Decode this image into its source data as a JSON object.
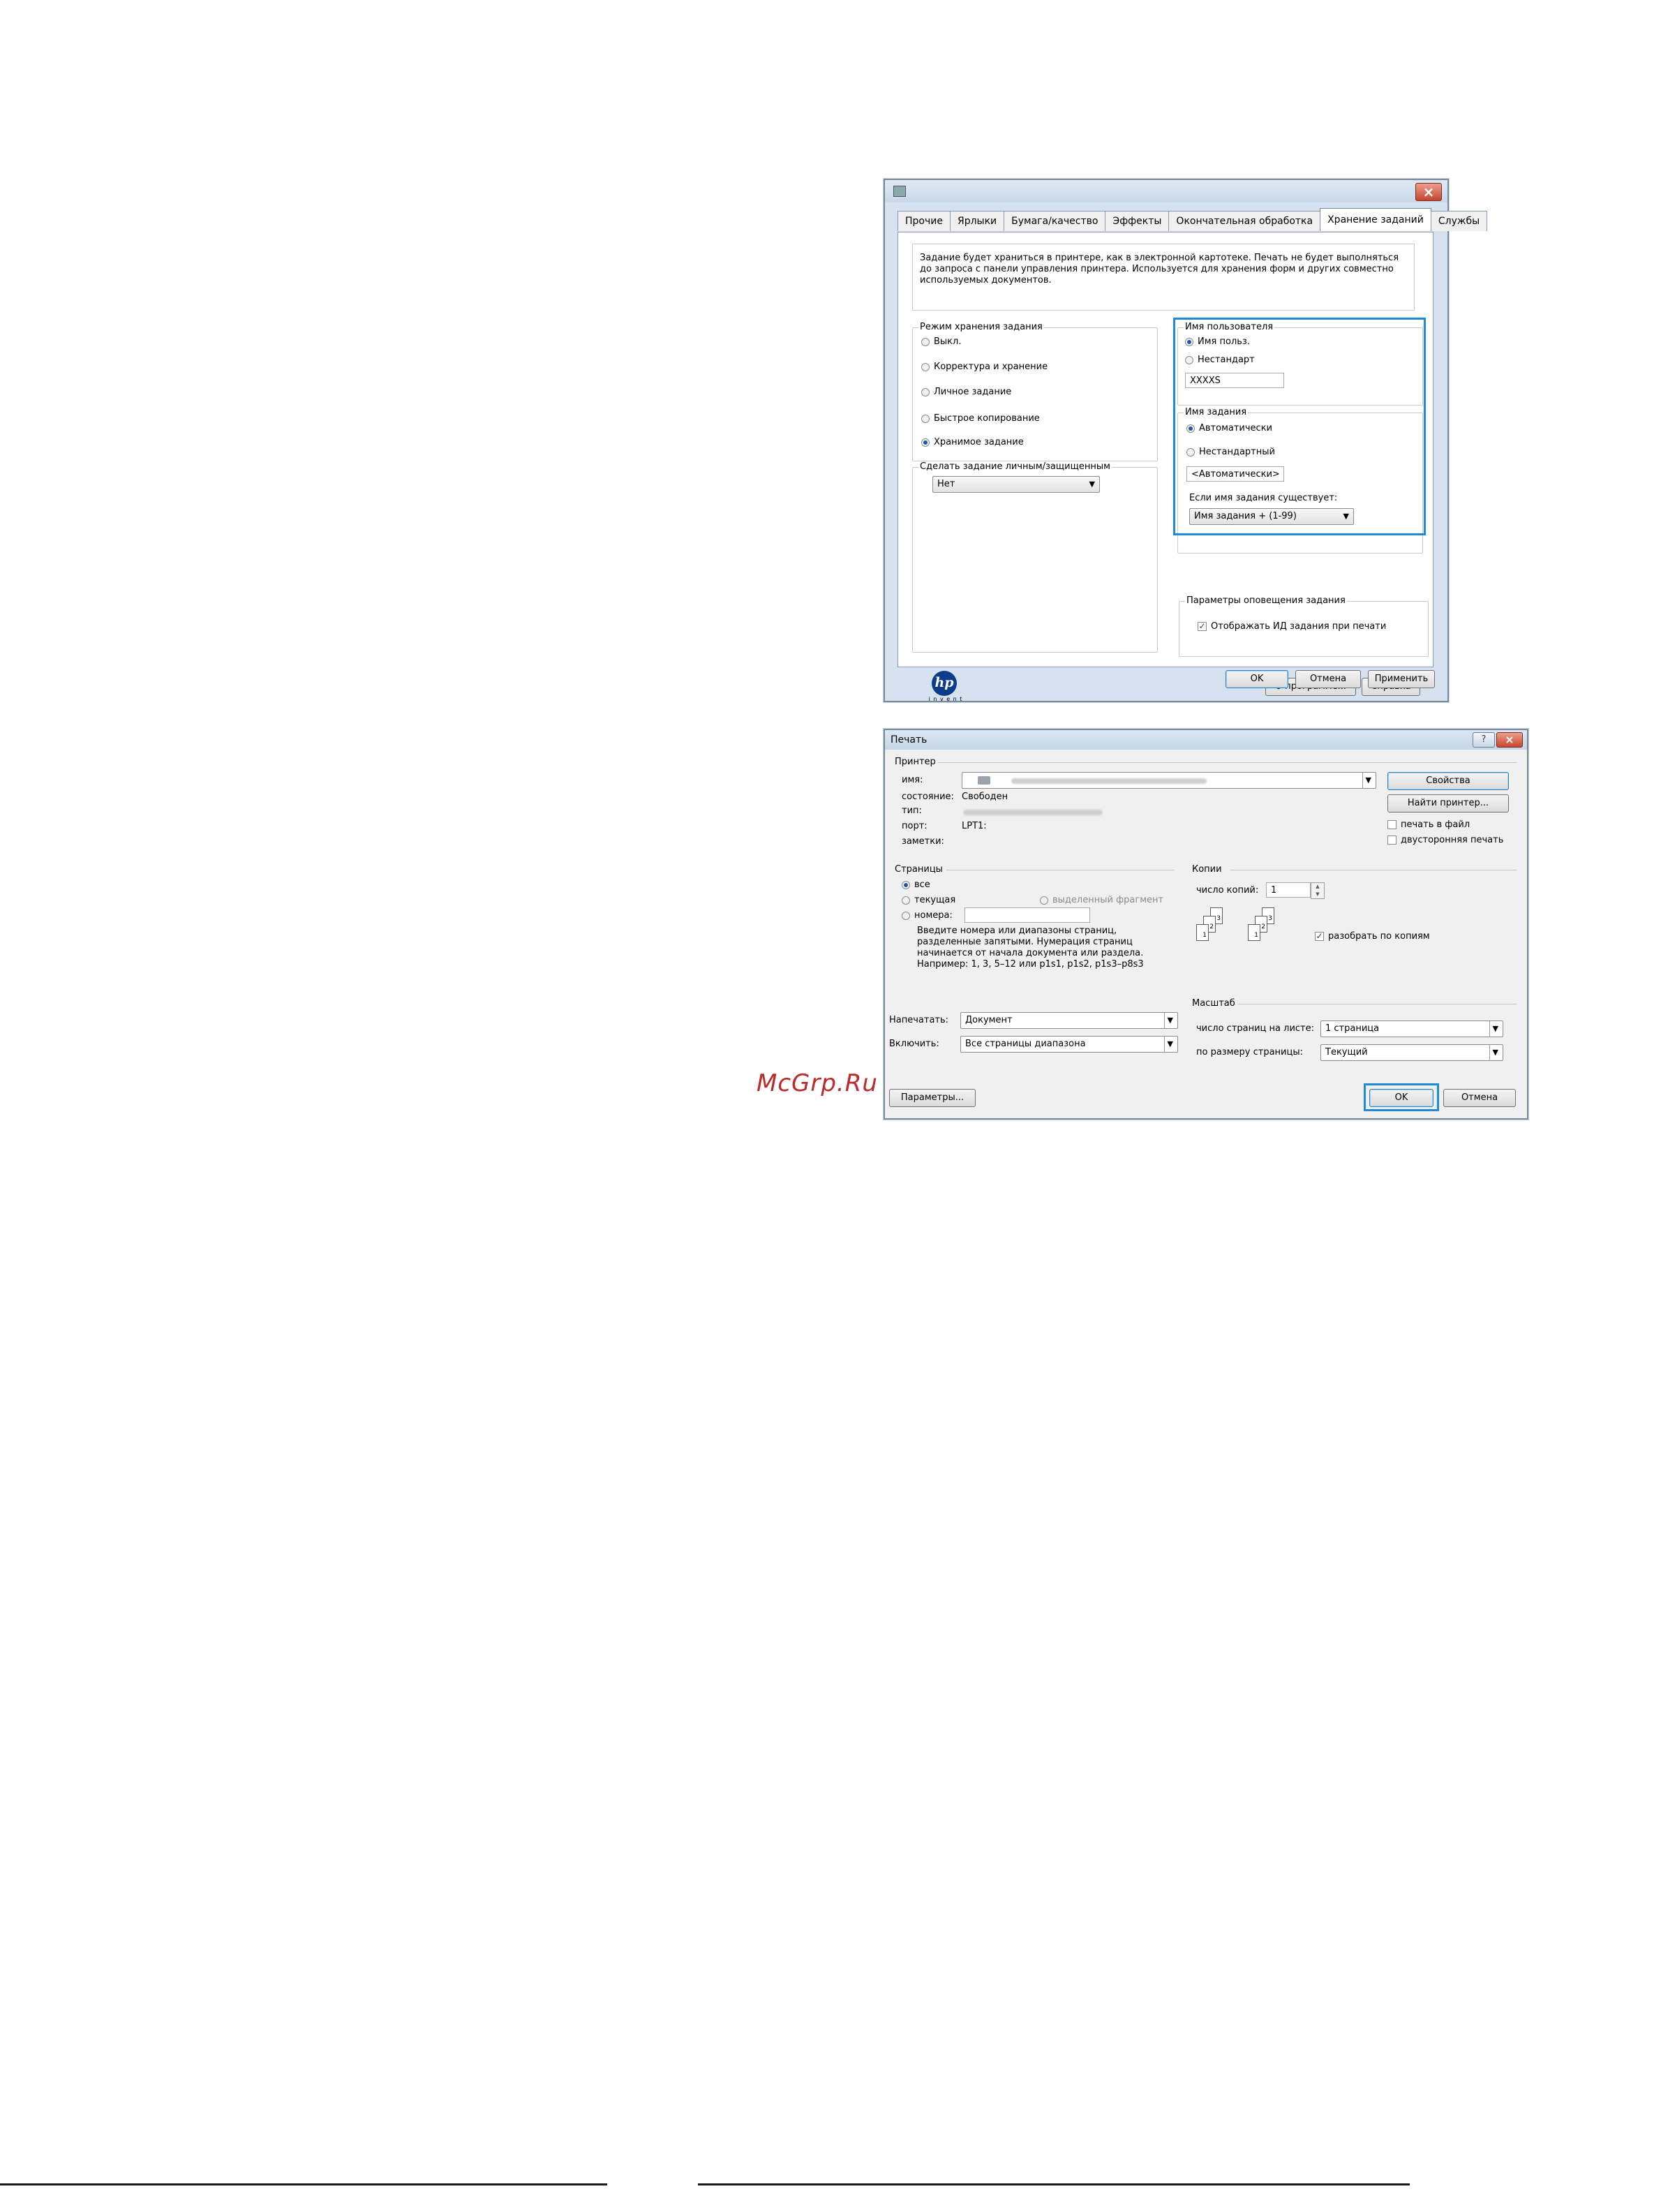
{
  "properties_dialog": {
    "tabs": [
      "Прочие",
      "Ярлыки",
      "Бумага/качество",
      "Эффекты",
      "Окончательная обработка",
      "Хранение заданий",
      "Службы"
    ],
    "active_tab": "Хранение заданий",
    "description": "Задание будет храниться в принтере, как в электронной картотеке. Печать не будет выполняться до запроса с панели управления принтера. Используется для хранения форм и других совместно используемых документов.",
    "storage_mode": {
      "label": "Режим хранения задания",
      "options": [
        "Выкл.",
        "Корректура и хранение",
        "Личное задание",
        "Быстрое копирование",
        "Хранимое задание"
      ],
      "selected": "Хранимое задание"
    },
    "private": {
      "label": "Сделать задание личным/защищенным",
      "value": "Нет"
    },
    "user_name": {
      "label": "Имя пользователя",
      "options": [
        "Имя польз.",
        "Нестандарт"
      ],
      "value": "XXXXS"
    },
    "job_name": {
      "label": "Имя задания",
      "options": [
        "Автоматически",
        "Нестандартный"
      ],
      "value": "<Автоматически>",
      "exists_label": "Если имя задания существует:",
      "exists_value": "Имя задания + (1-99)"
    },
    "notification": {
      "label": "Параметры оповещения задания",
      "checkbox": "Отображать ИД задания при печати",
      "checked": true
    },
    "logo_text": "i n v e n t",
    "buttons": {
      "about": "О программе...",
      "help": "Справка",
      "ok": "OK",
      "cancel": "Отмена",
      "apply": "Применить"
    }
  },
  "print_dialog": {
    "title": "Печать",
    "printer": {
      "label": "Принтер",
      "name_label": "имя:",
      "status_label": "состояние:",
      "status_value": "Свободен",
      "type_label": "тип:",
      "port_label": "порт:",
      "port_value": "LPT1:",
      "notes_label": "заметки:",
      "properties_button": "Свойства",
      "find_button": "Найти принтер...",
      "print_to_file": "печать в файл",
      "duplex": "двусторонняя печать"
    },
    "pages": {
      "label": "Страницы",
      "all": "все",
      "current": "текущая",
      "selection": "выделенный фрагмент",
      "numbers": "номера:",
      "hint": [
        "Введите номера или диапазоны страниц,",
        "разделенные запятыми. Нумерация страниц",
        "начинается от начала документа или раздела.",
        "Например: 1, 3, 5–12 или p1s1, p1s2, p1s3–p8s3"
      ]
    },
    "copies": {
      "label": "Копии",
      "count_label": "число копий:",
      "count_value": "1",
      "collate": "разобрать по копиям"
    },
    "print_what_label": "Напечатать:",
    "print_what_value": "Документ",
    "include_label": "Включить:",
    "include_value": "Все страницы диапазона",
    "zoom": {
      "label": "Масштаб",
      "pages_per_sheet_label": "число страниц на листе:",
      "pages_per_sheet_value": "1 страница",
      "scale_label": "по размеру страницы:",
      "scale_value": "Текущий"
    },
    "buttons": {
      "options": "Параметры...",
      "ok": "OK",
      "cancel": "Отмена"
    }
  },
  "watermark": "McGrp.Ru",
  "colors": {
    "highlight": "#1f8ad8",
    "watermark": "#bd2a2a"
  }
}
